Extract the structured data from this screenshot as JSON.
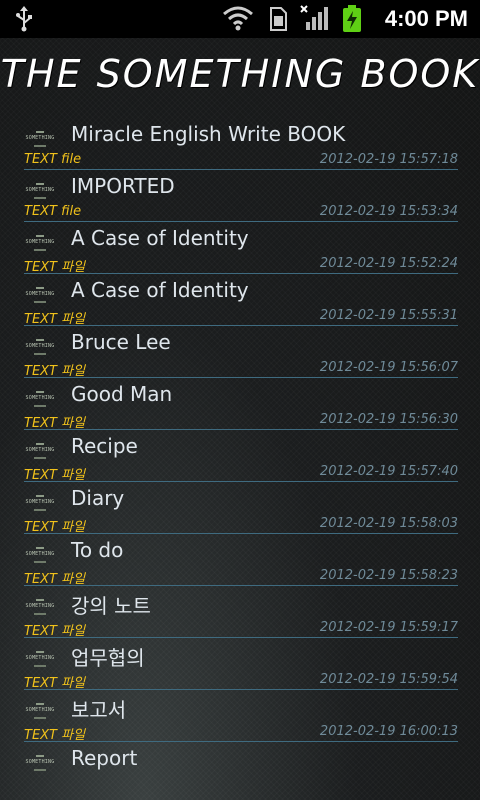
{
  "status_bar": {
    "time": "4:00 PM",
    "icons": [
      "usb-icon",
      "wifi-icon",
      "sim-icon",
      "signal-icon",
      "battery-charging-icon"
    ]
  },
  "app": {
    "title": "THE SOMETHING BOOK",
    "thumbnail_text": "SOMETHING"
  },
  "files": [
    {
      "title": "Miracle English Write BOOK",
      "type": "TEXT file",
      "date": "2012-02-19 15:57:18"
    },
    {
      "title": "IMPORTED",
      "type": "TEXT file",
      "date": "2012-02-19 15:53:34"
    },
    {
      "title": "A Case of Identity",
      "type": "TEXT 파일",
      "date": "2012-02-19 15:52:24"
    },
    {
      "title": "A Case of Identity",
      "type": "TEXT 파일",
      "date": "2012-02-19 15:55:31"
    },
    {
      "title": "Bruce Lee",
      "type": "TEXT 파일",
      "date": "2012-02-19 15:56:07"
    },
    {
      "title": "Good Man",
      "type": "TEXT 파일",
      "date": "2012-02-19 15:56:30"
    },
    {
      "title": "Recipe",
      "type": "TEXT 파일",
      "date": "2012-02-19 15:57:40"
    },
    {
      "title": "Diary",
      "type": "TEXT 파일",
      "date": "2012-02-19 15:58:03"
    },
    {
      "title": "To do",
      "type": "TEXT 파일",
      "date": "2012-02-19 15:58:23"
    },
    {
      "title": "강의 노트",
      "type": "TEXT 파일",
      "date": "2012-02-19 15:59:17"
    },
    {
      "title": "업무협의",
      "type": "TEXT 파일",
      "date": "2012-02-19 15:59:54"
    },
    {
      "title": "보고서",
      "type": "TEXT 파일",
      "date": "2012-02-19 16:00:13"
    },
    {
      "title": "Report",
      "type": "",
      "date": ""
    }
  ],
  "colors": {
    "title_text": "#dfe6ec",
    "type_text": "#f1c21b",
    "date_text": "#6f8a98",
    "divider": "#3f6b80"
  }
}
